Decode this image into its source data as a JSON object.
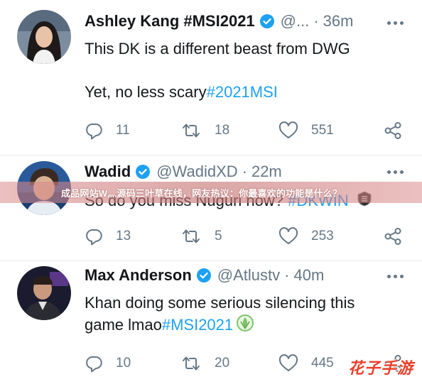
{
  "tweets": [
    {
      "name": "Ashley Kang #MSI2021",
      "handle": "@...",
      "separator": "·",
      "time": "36m",
      "line1": "This DK is a different beast from DWG",
      "line2_text": "Yet, no less scary",
      "line2_hashtag": "#2021MSI",
      "replies": "11",
      "retweets": "18",
      "likes": "551"
    },
    {
      "name": "Wadid",
      "handle": "@WadidXD",
      "separator": "·",
      "time": "22m",
      "text": "So do you miss Nuguri now? ",
      "hashtag": "#DKWIN",
      "replies": "13",
      "retweets": "5",
      "likes": "253"
    },
    {
      "name": "Max Anderson",
      "handle": "@Atlustv",
      "separator": "·",
      "time": "40m",
      "line1": "Khan doing some serious silencing this",
      "line2_text": "game lmao",
      "line2_hashtag": "#MSI2021",
      "replies": "10",
      "retweets": "20",
      "likes": "445"
    }
  ],
  "banner": "成品网站W灬源码三叶草在线，网友热议：你最喜欢的功能是什么？",
  "watermark": "花子手游",
  "colors": {
    "accent": "#1da1f2",
    "muted": "#657786",
    "text": "#14171a",
    "divider": "#e6ecf0"
  },
  "icons": [
    "verified-badge-icon",
    "more-icon",
    "reply-icon",
    "retweet-icon",
    "like-icon",
    "share-icon"
  ]
}
